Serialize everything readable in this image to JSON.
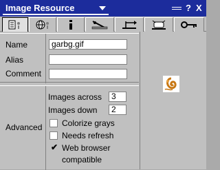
{
  "window": {
    "title": "Image Resource",
    "help_symbol": "?",
    "close_symbol": "X"
  },
  "tabs": [
    {
      "name": "general",
      "icon": "properties-icon",
      "active": true
    },
    {
      "name": "web",
      "icon": "globe-icon",
      "active": false
    },
    {
      "name": "info",
      "icon": "info-icon",
      "active": false
    },
    {
      "name": "tools",
      "icon": "tools-icon",
      "active": false
    },
    {
      "name": "layout",
      "icon": "layout-icon",
      "active": false
    },
    {
      "name": "events",
      "icon": "events-icon",
      "active": false
    },
    {
      "name": "security",
      "icon": "key-icon",
      "active": false
    }
  ],
  "form": {
    "name_label": "Name",
    "name_value": "garbg.gif",
    "alias_label": "Alias",
    "alias_value": "",
    "comment_label": "Comment",
    "comment_value": ""
  },
  "advanced": {
    "label": "Advanced",
    "images_across_label": "Images across",
    "images_across_value": "3",
    "images_down_label": "Images down",
    "images_down_value": "2",
    "colorize_grays_label": "Colorize grays",
    "colorize_grays_checked": false,
    "needs_refresh_label": "Needs refresh",
    "needs_refresh_checked": false,
    "web_browser_label_line1": "Web browser",
    "web_browser_label_line2": "compatible",
    "web_browser_checked": true,
    "check_mark": "✔"
  },
  "preview": {
    "icon": "image-preview-icon"
  },
  "colors": {
    "titlebar": "#1c2c9c",
    "panel": "#c0c0c0"
  }
}
